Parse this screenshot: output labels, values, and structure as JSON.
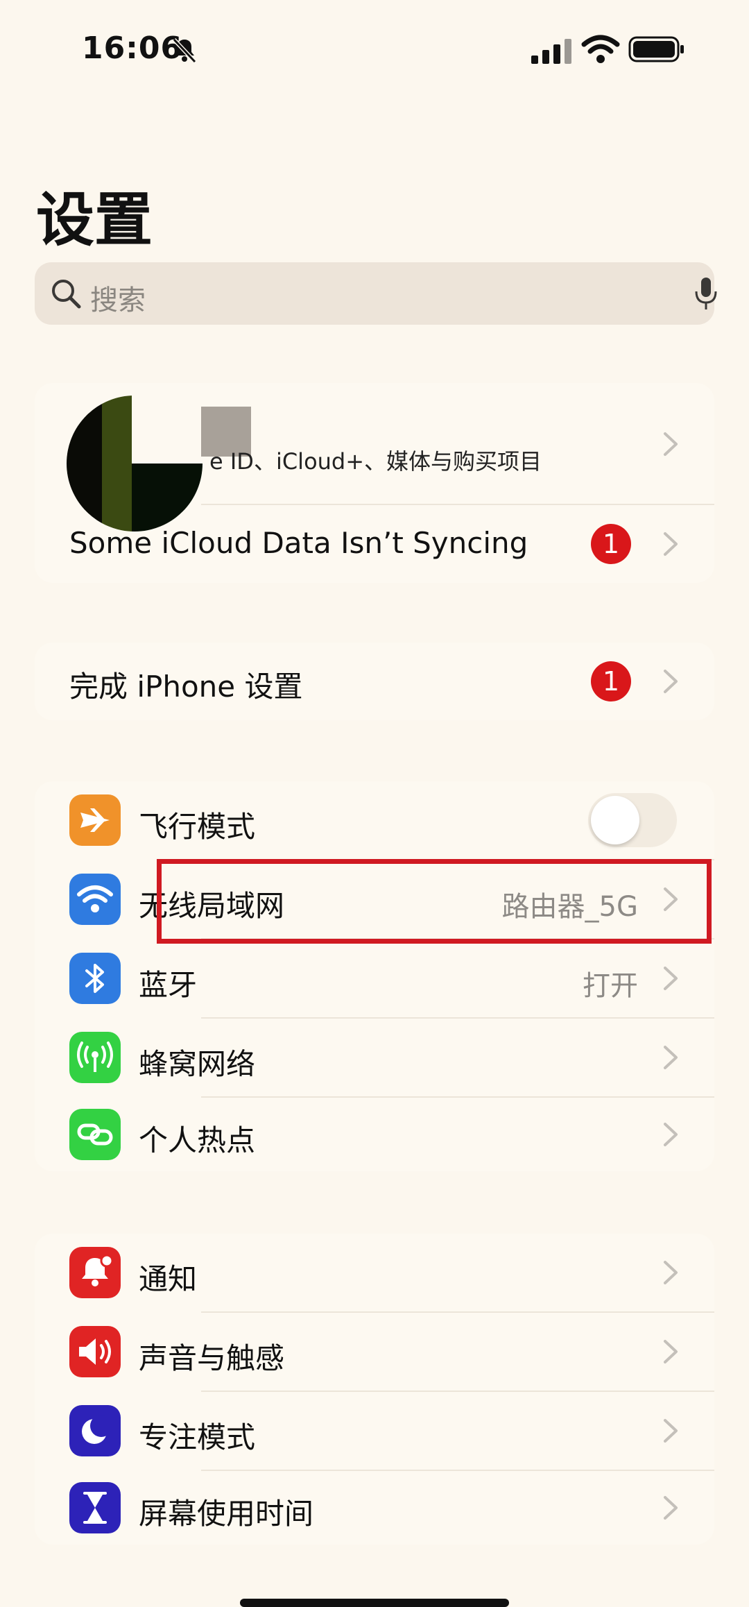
{
  "status_bar": {
    "time": "16:06",
    "silent_icon": "bell-slash-icon",
    "signal_icon": "cellular-signal-icon",
    "wifi_icon": "wifi-icon",
    "battery_icon": "battery-icon"
  },
  "page_title": "设置",
  "search": {
    "placeholder": "搜索",
    "search_icon": "search-icon",
    "mic_icon": "microphone-icon"
  },
  "account": {
    "subtitle": "e ID、iCloud+、媒体与购买项目",
    "sync_warning": "Some iCloud Data Isn’t Syncing",
    "sync_badge": "1"
  },
  "setup": {
    "label": "完成 iPhone 设置",
    "badge": "1"
  },
  "connectivity": [
    {
      "icon": "airplane-icon",
      "label": "飞行模式",
      "color": "#f0922a",
      "toggle": false
    },
    {
      "icon": "wifi-icon",
      "label": "无线局域网",
      "value": "路由器_5G",
      "color": "#2f7be0"
    },
    {
      "icon": "bluetooth-icon",
      "label": "蓝牙",
      "value": "打开",
      "color": "#2f7be0"
    },
    {
      "icon": "antenna-icon",
      "label": "蜂窝网络",
      "color": "#33d143"
    },
    {
      "icon": "hotspot-icon",
      "label": "个人热点",
      "color": "#33d143"
    }
  ],
  "system": [
    {
      "icon": "notification-icon",
      "label": "通知",
      "color": "#e02424"
    },
    {
      "icon": "speaker-icon",
      "label": "声音与触感",
      "color": "#e02424"
    },
    {
      "icon": "moon-icon",
      "label": "专注模式",
      "color": "#2d22b8"
    },
    {
      "icon": "hourglass-icon",
      "label": "屏幕使用时间",
      "color": "#2d22b8"
    }
  ]
}
